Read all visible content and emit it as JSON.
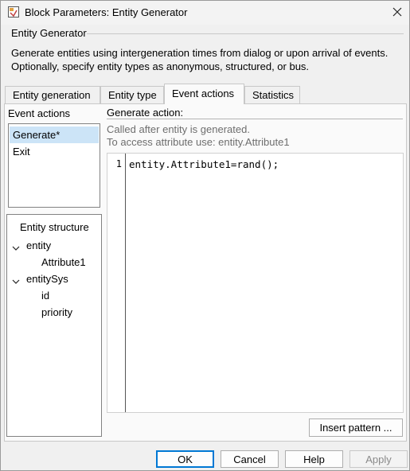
{
  "window": {
    "title": "Block Parameters: Entity Generator",
    "app_icon": "simulink-block-icon",
    "close_icon": "close-icon"
  },
  "block": {
    "name": "Entity Generator",
    "description_line1": "Generate entities using intergeneration times from dialog or upon arrival of events.",
    "description_line2": "Optionally, specify entity types as anonymous, structured, or bus."
  },
  "tabs": [
    {
      "label": "Entity generation",
      "active": false
    },
    {
      "label": "Entity type",
      "active": false
    },
    {
      "label": "Event actions",
      "active": true
    },
    {
      "label": "Statistics",
      "active": false
    }
  ],
  "event_actions": {
    "label": "Event actions",
    "items": [
      {
        "label": "Generate*",
        "selected": true
      },
      {
        "label": "Exit",
        "selected": false
      }
    ]
  },
  "entity_structure": {
    "title": "Entity structure",
    "tree": [
      {
        "label": "entity",
        "expanded": true,
        "children": [
          "Attribute1"
        ]
      },
      {
        "label": "entitySys",
        "expanded": true,
        "children": [
          "id",
          "priority"
        ]
      }
    ]
  },
  "generate_action": {
    "label": "Generate action:",
    "hint_line1": "Called after entity is generated.",
    "hint_line2": "To access attribute use: entity.Attribute1",
    "line_number": "1",
    "code": "entity.Attribute1=rand();"
  },
  "buttons": {
    "insert_pattern": "Insert pattern ...",
    "ok": "OK",
    "cancel": "Cancel",
    "help": "Help",
    "apply": "Apply"
  },
  "colors": {
    "selection": "#cce4f7",
    "default_button_border": "#0078d4",
    "hint_text": "#6e6e6e"
  }
}
